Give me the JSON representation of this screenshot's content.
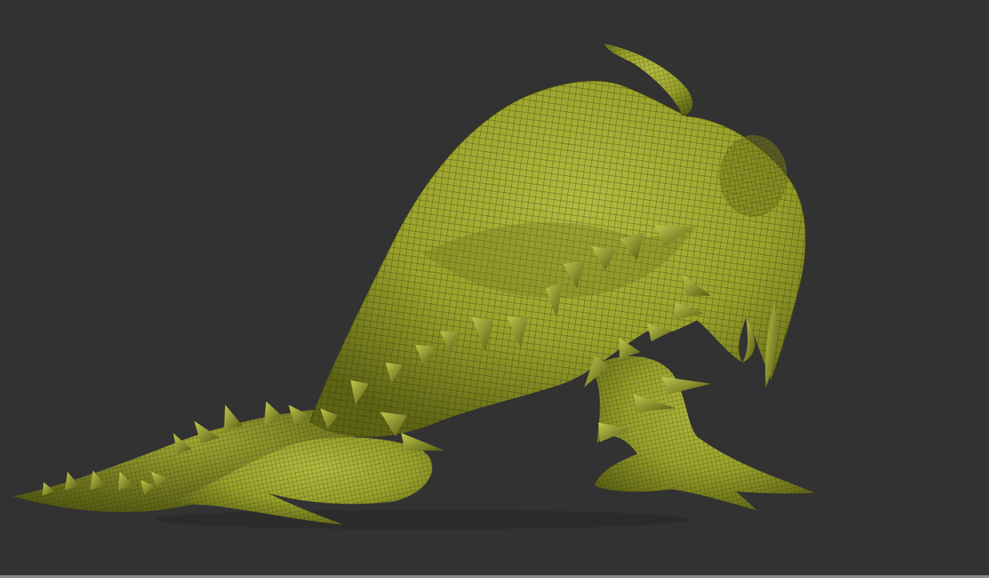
{
  "viewport": {
    "background_color": "#323232",
    "subject": "creature-sculpt-mesh",
    "mesh_color": "#9da52c",
    "wireframe_color": "#2a2a10",
    "shading": "matcap-with-polyframe"
  },
  "icons": {
    "model": "sculpt-mesh-icon"
  }
}
